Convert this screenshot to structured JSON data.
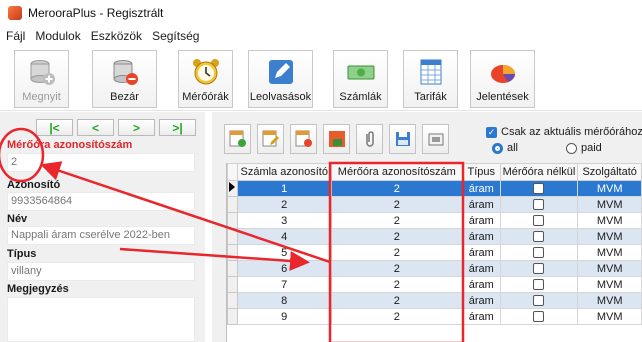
{
  "window": {
    "title": "MerooraPlus - Regisztrált"
  },
  "menu": [
    "Fájl",
    "Modulok",
    "Eszközök",
    "Segítség"
  ],
  "toolbar": [
    {
      "label": "Megnyit",
      "icon": "database-add-icon",
      "disabled": true
    },
    {
      "label": "Bezár",
      "icon": "database-remove-icon",
      "disabled": false
    },
    {
      "label": "Mérőórák",
      "icon": "alarm-clock-icon",
      "disabled": false
    },
    {
      "label": "Leolvasások",
      "icon": "pencil-icon",
      "disabled": false
    },
    {
      "label": "Számlák",
      "icon": "banknote-icon",
      "disabled": false
    },
    {
      "label": "Tarifák",
      "icon": "spreadsheet-icon",
      "disabled": false
    },
    {
      "label": "Jelentések",
      "icon": "pie-chart-icon",
      "disabled": false
    }
  ],
  "nav": {
    "first": "|<",
    "prev": "<",
    "next": ">",
    "last": ">|"
  },
  "form": {
    "meter_id_label": "Mérőóra azonosítószám",
    "meter_id_value": "2",
    "id_label": "Azonosító",
    "id_value": "9933564864",
    "name_label": "Név",
    "name_value": "Nappali áram cserélve 2022-ben",
    "type_label": "Típus",
    "type_value": "villany",
    "note_label": "Megjegyzés"
  },
  "filter": {
    "only_current_label": "Csak az aktuális mérőórához t",
    "only_current_checked": true,
    "radio_all": "all",
    "radio_paid": "paid",
    "selected": "all"
  },
  "table": {
    "columns": [
      "Számla azonosító",
      "Mérőóra azonosítószám",
      "Típus",
      "Mérőóra nélkül",
      "Szolgáltató"
    ],
    "rows": [
      {
        "id": "1",
        "meter": "2",
        "type": "áram",
        "no_meter": false,
        "provider": "MVM"
      },
      {
        "id": "2",
        "meter": "2",
        "type": "áram",
        "no_meter": false,
        "provider": "MVM"
      },
      {
        "id": "3",
        "meter": "2",
        "type": "áram",
        "no_meter": false,
        "provider": "MVM"
      },
      {
        "id": "4",
        "meter": "2",
        "type": "áram",
        "no_meter": false,
        "provider": "MVM"
      },
      {
        "id": "5",
        "meter": "2",
        "type": "áram",
        "no_meter": false,
        "provider": "MVM"
      },
      {
        "id": "6",
        "meter": "2",
        "type": "áram",
        "no_meter": false,
        "provider": "MVM"
      },
      {
        "id": "7",
        "meter": "2",
        "type": "áram",
        "no_meter": false,
        "provider": "MVM"
      },
      {
        "id": "8",
        "meter": "2",
        "type": "áram",
        "no_meter": false,
        "provider": "MVM"
      },
      {
        "id": "9",
        "meter": "2",
        "type": "áram",
        "no_meter": false,
        "provider": "MVM"
      }
    ],
    "selected_row": 0
  },
  "annotation_color": "#e8262b",
  "accent_color": "#2b78d0"
}
